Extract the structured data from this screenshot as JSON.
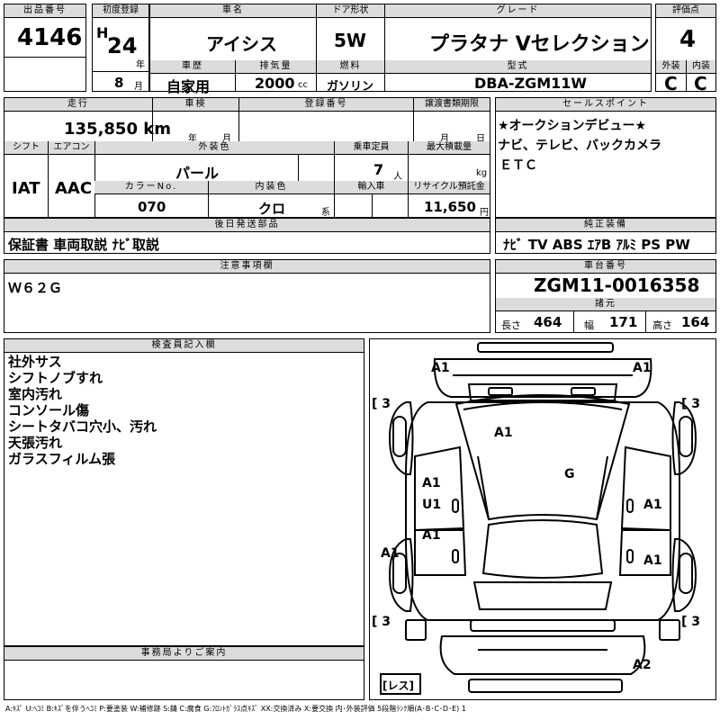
{
  "header": {
    "lot_label": "出品番号",
    "lot_value": "4146",
    "reg_label": "初度登録",
    "era": "H",
    "year": "24",
    "year_unit": "年",
    "month": "8",
    "month_unit": "月",
    "name_label": "車名",
    "name_value": "アイシス",
    "door_label": "ドア形状",
    "door_value": "5W",
    "grade_label": "グレード",
    "grade_value": "プラタナ Vセレクション",
    "score_label": "評価点",
    "score_value": "4",
    "history_label": "車歴",
    "history_value": "自家用",
    "disp_label": "排気量",
    "disp_value": "2000",
    "disp_unit": "cc",
    "fuel_label": "燃料",
    "fuel_value": "ガソリン",
    "model_label": "型式",
    "model_value": "DBA-ZGM11W",
    "ext_label": "外装",
    "ext_value": "C",
    "int_label": "内装",
    "int_value": "C"
  },
  "row2": {
    "mileage_label": "走行",
    "mileage_value": "135,850 km",
    "inspection_label": "車検",
    "insp_year": "年",
    "insp_month": "月",
    "regno_label": "登録番号",
    "transfer_label": "譲渡書類期限",
    "tr_month": "月",
    "tr_day": "日",
    "shift_label": "シフト",
    "shift_value": "IAT",
    "ac_label": "エアコン",
    "ac_value": "AAC",
    "color_label": "外装色",
    "color_value": "パール",
    "capacity_label": "乗車定員",
    "capacity_value": "7",
    "capacity_unit": "人",
    "load_label": "最大積載量",
    "load_unit": "kg",
    "colorno_label": "カラーNo.",
    "colorno_value": "070",
    "intcolor_label": "内装色",
    "intcolor_value": "クロ",
    "intcolor_unit": "系",
    "import_label": "輸入車",
    "recycle_label": "リサイクル預託金",
    "recycle_value": "11,650",
    "recycle_unit": "円"
  },
  "sales_points": {
    "label": "セールスポイント",
    "lines": [
      "★オークションデビュー★",
      "ナビ、テレビ、バックカメラ",
      "ＥＴＣ"
    ]
  },
  "shipped_parts": {
    "label": "後日発送部品",
    "value": "保証書 車両取説 ﾅﾋﾞ取説"
  },
  "equipment": {
    "label": "純正装備",
    "value": "ﾅﾋﾞ TV ABS ｴｱB ｱﾙﾐ PS PW"
  },
  "notes": {
    "label": "注意事項欄",
    "value": "Ｗ６２Ｇ"
  },
  "chassis": {
    "label": "車台番号",
    "value": "ZGM11-0016358"
  },
  "dims": {
    "label": "諸元",
    "length_label": "長さ",
    "length_value": "464",
    "width_label": "幅",
    "width_value": "171",
    "height_label": "高さ",
    "height_value": "164"
  },
  "inspector": {
    "label": "検査員記入欄",
    "lines": [
      "社外サス",
      "シフトノブすれ",
      "室内汚れ",
      "コンソール傷",
      "シートタバコ穴小、汚れ",
      "天張汚れ",
      "ガラスフィルム張"
    ]
  },
  "office": {
    "label": "事務局よりご案内"
  },
  "diagram": {
    "marks": {
      "fl": "A1",
      "fr": "A1",
      "roof": "A1",
      "glass": "G",
      "d1": "A1",
      "d2": "U1",
      "d3": "A1",
      "lside": "A1",
      "r1": "A1",
      "r2": "A1",
      "rear": "A2",
      "t1": "3",
      "t2": "3",
      "t3": "3",
      "t4": "3",
      "tire_open": "[",
      "tire_close": "]",
      "les": "[レス]"
    }
  },
  "legend": "A:ｷｽﾞ U:ﾍｺﾐ B:ｷｽﾞを伴うﾍｺﾐ P:要塗装 W:補修跡 S:錆 C:腐食 G:ﾌﾛﾝﾄｶﾞﾗｽ点ｷｽﾞ XX:交換済み X:要交換 内･外装評価 5段階ﾗﾝｸ順(A･B･C･D･E) 1"
}
